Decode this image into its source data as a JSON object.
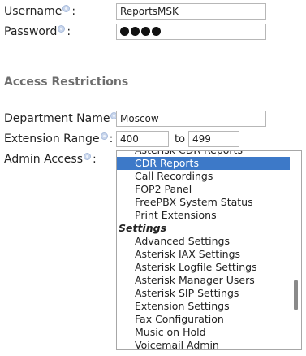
{
  "form": {
    "username": {
      "label": "Username",
      "colon": ":",
      "value": "ReportsMSK"
    },
    "password": {
      "label": "Password",
      "colon": ":",
      "masked_length": 4
    },
    "section_title": "Access Restrictions",
    "department": {
      "label": "Department Name",
      "colon": ":",
      "value": "Moscow"
    },
    "extension_range": {
      "label": "Extension Range",
      "colon": ":",
      "from": "400",
      "to_label": "to",
      "to": "499"
    },
    "admin_access": {
      "label": "Admin Access",
      "colon": ":",
      "options": [
        {
          "type": "option",
          "label": "Asterisk CDR Reports",
          "selected": false
        },
        {
          "type": "option",
          "label": "CDR Reports",
          "selected": true
        },
        {
          "type": "option",
          "label": "Call Recordings",
          "selected": false
        },
        {
          "type": "option",
          "label": "FOP2 Panel",
          "selected": false
        },
        {
          "type": "option",
          "label": "FreePBX System Status",
          "selected": false
        },
        {
          "type": "option",
          "label": "Print Extensions",
          "selected": false
        },
        {
          "type": "group",
          "label": "Settings"
        },
        {
          "type": "option",
          "label": "Advanced Settings",
          "selected": false
        },
        {
          "type": "option",
          "label": "Asterisk IAX Settings",
          "selected": false
        },
        {
          "type": "option",
          "label": "Asterisk Logfile Settings",
          "selected": false
        },
        {
          "type": "option",
          "label": "Asterisk Manager Users",
          "selected": false
        },
        {
          "type": "option",
          "label": "Asterisk SIP Settings",
          "selected": false
        },
        {
          "type": "option",
          "label": "Extension Settings",
          "selected": false
        },
        {
          "type": "option",
          "label": "Fax Configuration",
          "selected": false
        },
        {
          "type": "option",
          "label": "Music on Hold",
          "selected": false
        },
        {
          "type": "option",
          "label": "Voicemail Admin",
          "selected": false
        }
      ]
    }
  },
  "colors": {
    "selected_bg": "#3d79c8",
    "section_title": "#6e6e6e",
    "help_icon": "#c9d6ec"
  }
}
